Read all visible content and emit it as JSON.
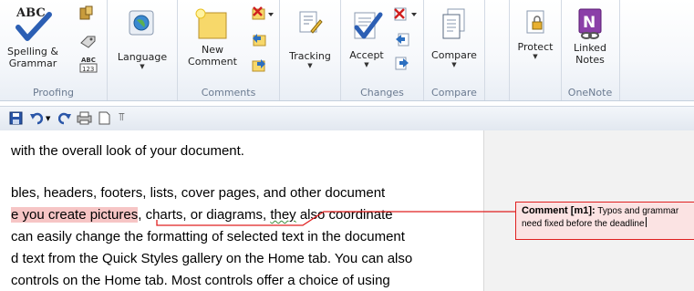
{
  "ribbon": {
    "groups": {
      "proofing": {
        "label": "Proofing",
        "spelling_line1": "Spelling &",
        "spelling_line2": "Grammar",
        "abc_icon_text": "ABC",
        "wordcount_icon_text": "ABC\n123"
      },
      "language": {
        "label": "Language"
      },
      "comments": {
        "label": "Comments",
        "new_line1": "New",
        "new_line2": "Comment"
      },
      "tracking": {
        "label": "Tracking"
      },
      "changes": {
        "label": "Changes",
        "accept": "Accept"
      },
      "compare": {
        "label": "Compare",
        "compare_button": "Compare"
      },
      "protect": {
        "label": "Protect"
      },
      "onenote": {
        "label": "OneNote",
        "linked_line1": "Linked",
        "linked_line2": "Notes",
        "icon_letter": "N"
      }
    }
  },
  "document": {
    "lines": [
      "with the overall look of your document.",
      "bles, headers, footers, lists, cover pages, and other document",
      "e you create pictures",
      ", charts, or diagrams, ",
      "they",
      " also coordinate",
      " can easily change the formatting of selected text in the document",
      "d text from the Quick Styles gallery on the Home tab. You can also",
      "controls on the Home tab. Most controls offer a choice of using"
    ]
  },
  "comment": {
    "label": "Comment [m1]:",
    "text_line1": " Typos and grammar",
    "text_line2": "need fixed before the deadline"
  },
  "colors": {
    "comment_border": "#e02020",
    "comment_fill": "#fbe3e3",
    "highlight": "#f6c5c5",
    "markup_pane": "#f2f2f2"
  }
}
